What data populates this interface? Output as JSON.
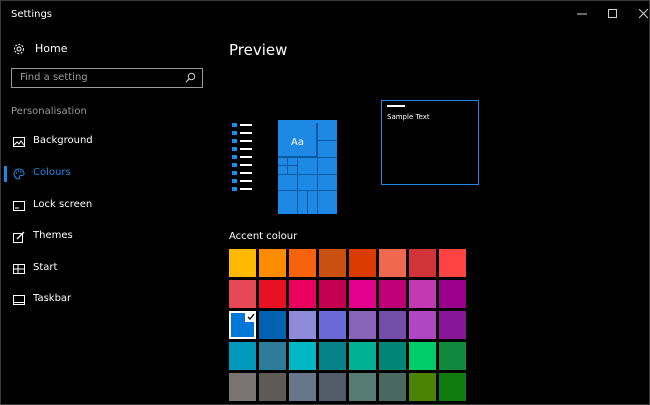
{
  "window": {
    "title": "Settings",
    "controls": [
      "minimize",
      "maximize",
      "close"
    ]
  },
  "sidebar": {
    "home_label": "Home",
    "search_placeholder": "Find a setting",
    "section_label": "Personalisation",
    "items": [
      {
        "label": "Background",
        "icon": "picture-icon"
      },
      {
        "label": "Colours",
        "icon": "palette-icon",
        "active": true
      },
      {
        "label": "Lock screen",
        "icon": "lock-screen-icon"
      },
      {
        "label": "Themes",
        "icon": "brush-icon"
      },
      {
        "label": "Start",
        "icon": "start-grid-icon"
      },
      {
        "label": "Taskbar",
        "icon": "taskbar-icon"
      }
    ]
  },
  "main": {
    "preview_title": "Preview",
    "tile_text": "Aa",
    "sample_text": "Sample Text",
    "accent_label": "Accent colour",
    "selected_colour": "#0078d7",
    "swatches": [
      [
        "#ffb900",
        "#ff8c00",
        "#f7630c",
        "#ca5010",
        "#da3b01",
        "#ef6950",
        "#d13438",
        "#ff4343"
      ],
      [
        "#e74856",
        "#e81123",
        "#ea005e",
        "#c30052",
        "#e3008c",
        "#bf0077",
        "#c239b3",
        "#9a0089"
      ],
      [
        "#0078d7",
        "#0063b1",
        "#8e8cd8",
        "#6b69d6",
        "#8764b8",
        "#744da9",
        "#b146c2",
        "#881798"
      ],
      [
        "#0099bc",
        "#2d7d9a",
        "#00b7c3",
        "#038387",
        "#00b294",
        "#018574",
        "#00cc6a",
        "#10893e"
      ],
      [
        "#7a7574",
        "#5d5a58",
        "#68768a",
        "#515c6b",
        "#567c73",
        "#486860",
        "#498205",
        "#107c10"
      ]
    ]
  }
}
